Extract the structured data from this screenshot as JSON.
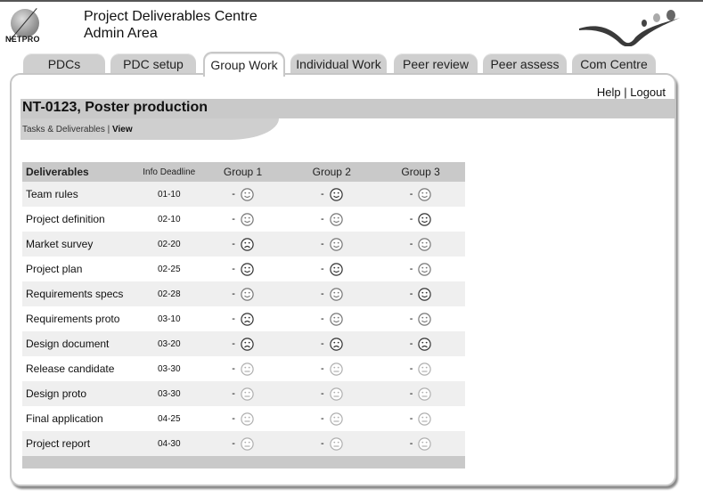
{
  "header": {
    "logo_text": "NETPRO",
    "title_line1": "Project Deliverables Centre",
    "title_line2": "Admin Area"
  },
  "tabs": [
    {
      "label": "PDCs",
      "active": false
    },
    {
      "label": "PDC setup",
      "active": false
    },
    {
      "label": "Group Work",
      "active": true
    },
    {
      "label": "Individual Work",
      "active": false
    },
    {
      "label": "Peer review",
      "active": false
    },
    {
      "label": "Peer assess",
      "active": false
    },
    {
      "label": "Com Centre",
      "active": false
    }
  ],
  "links": {
    "help": "Help",
    "separator": "|",
    "logout": "Logout"
  },
  "page_title": "NT-0123, Poster production",
  "breadcrumb": {
    "section": "Tasks & Deliverables",
    "separator": "|",
    "current": "View"
  },
  "table": {
    "headers": {
      "deliverables": "Deliverables",
      "info": "Info",
      "deadline": "Deadline",
      "groups": [
        "Group 1",
        "Group 2",
        "Group 3"
      ]
    },
    "dash": "-",
    "rows": [
      {
        "name": "Team rules",
        "deadline": "01-10",
        "status": [
          "happy-light",
          "happy-dark",
          "happy-light"
        ]
      },
      {
        "name": "Project definition",
        "deadline": "02-10",
        "status": [
          "happy-light",
          "happy-light",
          "happy-dark"
        ]
      },
      {
        "name": "Market survey",
        "deadline": "02-20",
        "status": [
          "sad-dark",
          "happy-light",
          "happy-light"
        ]
      },
      {
        "name": "Project plan",
        "deadline": "02-25",
        "status": [
          "happy-dark",
          "happy-dark",
          "happy-light"
        ]
      },
      {
        "name": "Requirements specs",
        "deadline": "02-28",
        "status": [
          "happy-light",
          "happy-light",
          "happy-dark"
        ]
      },
      {
        "name": "Requirements proto",
        "deadline": "03-10",
        "status": [
          "sad-dark",
          "happy-light",
          "happy-light"
        ]
      },
      {
        "name": "Design document",
        "deadline": "03-20",
        "status": [
          "sad-dark",
          "sad-dark",
          "sad-dark"
        ]
      },
      {
        "name": "Release candidate",
        "deadline": "03-30",
        "status": [
          "neutral",
          "neutral",
          "neutral"
        ]
      },
      {
        "name": "Design proto",
        "deadline": "03-30",
        "status": [
          "neutral",
          "neutral",
          "neutral"
        ]
      },
      {
        "name": "Final application",
        "deadline": "04-25",
        "status": [
          "neutral",
          "neutral",
          "neutral"
        ]
      },
      {
        "name": "Project report",
        "deadline": "04-30",
        "status": [
          "neutral",
          "neutral",
          "neutral"
        ]
      }
    ]
  },
  "colors": {
    "face_dark": "#333333",
    "face_light": "#777777",
    "face_neutral": "#b0b0b0",
    "header_bg": "#c9c9c9",
    "row_alt": "#efefef"
  }
}
